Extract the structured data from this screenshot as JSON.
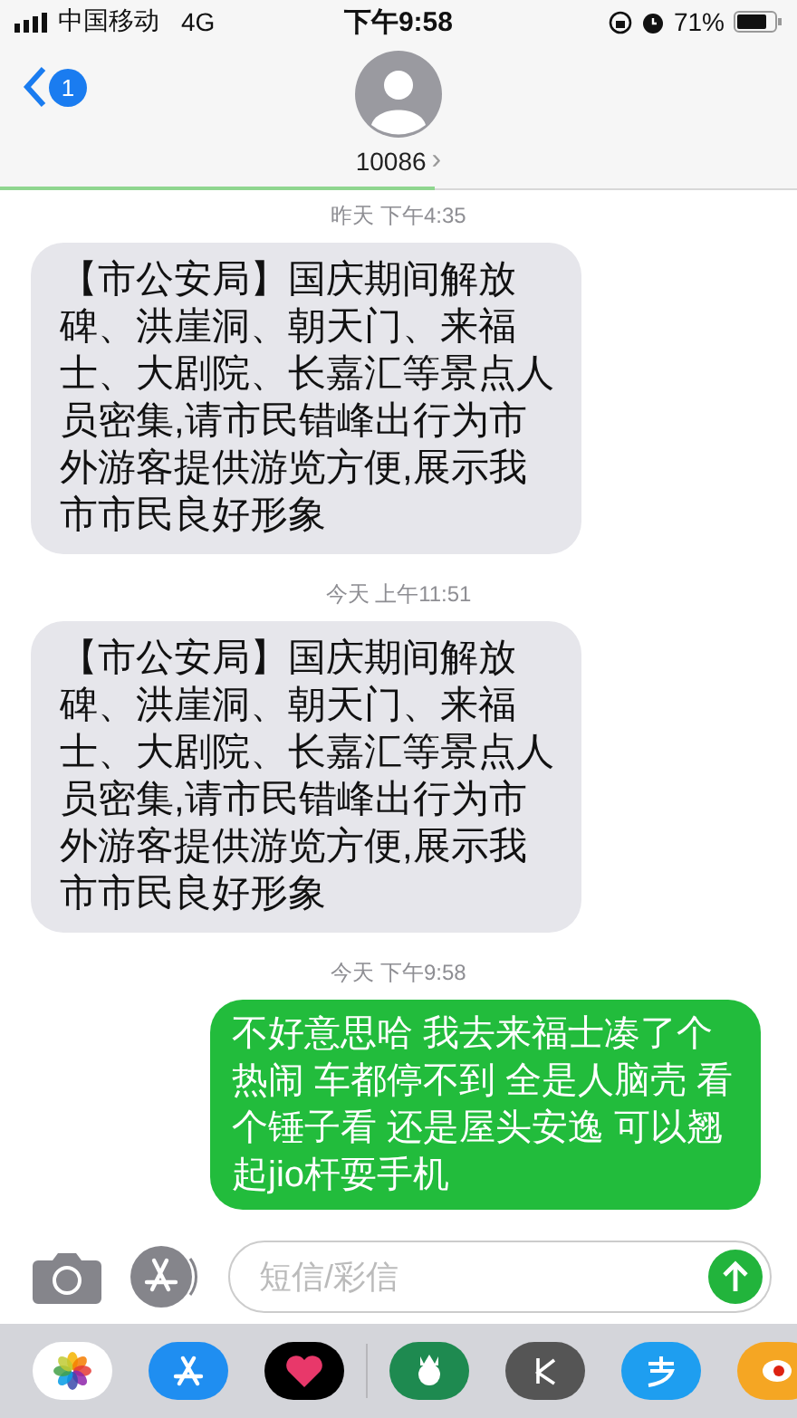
{
  "status_bar": {
    "carrier": "中国移动",
    "network": "4G",
    "time": "下午9:58",
    "battery": "71%"
  },
  "header": {
    "unread_badge": "1",
    "contact": "10086",
    "chevron": "›"
  },
  "messages": [
    {
      "kind": "timestamp",
      "text": "昨天 下午4:35"
    },
    {
      "kind": "incoming",
      "text": "【市公安局】国庆期间解放碑、洪崖洞、朝天门、来福士、大剧院、长嘉汇等景点人员密集,请市民错峰出行为市外游客提供游览方便,展示我市市民良好形象"
    },
    {
      "kind": "timestamp",
      "text": "今天 上午11:51"
    },
    {
      "kind": "incoming",
      "text": "【市公安局】国庆期间解放碑、洪崖洞、朝天门、来福士、大剧院、长嘉汇等景点人员密集,请市民错峰出行为市外游客提供游览方便,展示我市市民良好形象"
    },
    {
      "kind": "timestamp",
      "text": "今天 下午9:58"
    },
    {
      "kind": "outgoing",
      "text": "不好意思哈 我去来福士凑了个热闹 车都停不到 全是人脑壳 看个锤子看 还是屋头安逸 可以翘起jio杆耍手机"
    }
  ],
  "composer": {
    "placeholder": "短信/彩信"
  },
  "app_drawer": [
    {
      "kind": "photos"
    },
    {
      "kind": "appstore"
    },
    {
      "kind": "heart"
    },
    {
      "kind": "divider"
    },
    {
      "kind": "coffee"
    },
    {
      "kind": "k"
    },
    {
      "kind": "pay"
    },
    {
      "kind": "orange"
    }
  ]
}
